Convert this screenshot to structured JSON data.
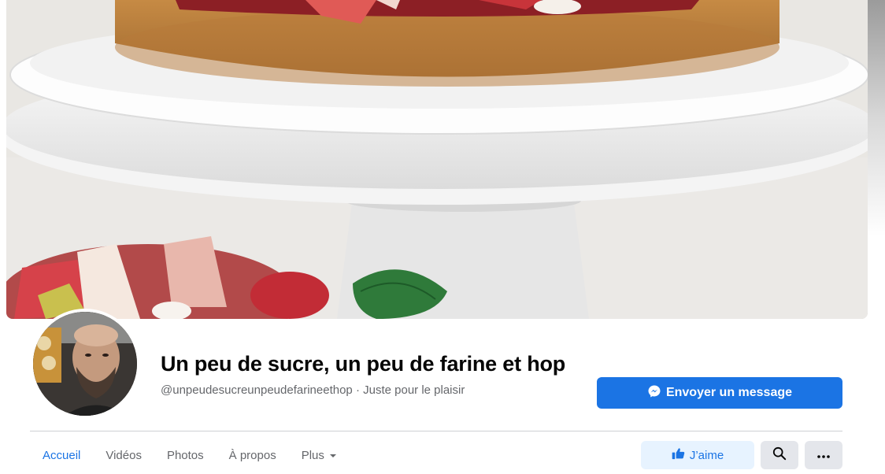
{
  "page": {
    "name": "Un peu de sucre, un peu de farine et hop",
    "handle": "@unpeudesucreunpeudefarineethop",
    "separator": "·",
    "category": "Juste pour le plaisir"
  },
  "actions": {
    "message_label": "Envoyer un message",
    "like_label": "J’aime"
  },
  "tabs": [
    {
      "label": "Accueil",
      "active": true
    },
    {
      "label": "Vidéos",
      "active": false
    },
    {
      "label": "Photos",
      "active": false
    },
    {
      "label": "À propos",
      "active": false
    },
    {
      "label": "Plus",
      "active": false
    }
  ],
  "colors": {
    "accent": "#1b74e4",
    "like_bg": "#e7f3ff",
    "secondary_text": "#65676b"
  },
  "icons": {
    "messenger": "messenger-icon",
    "like": "thumbs-up-icon",
    "search": "search-icon",
    "more": "more-dots-icon",
    "dropdown": "caret-down-icon"
  }
}
